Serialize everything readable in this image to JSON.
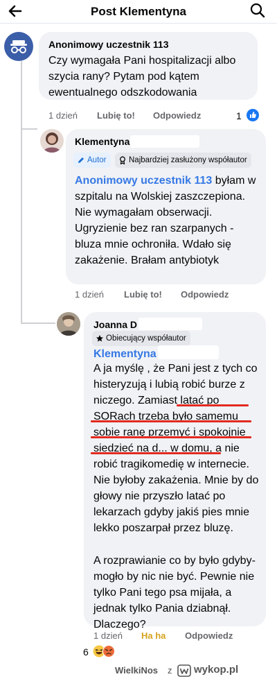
{
  "header": {
    "title": "Post Klementyna"
  },
  "comments": [
    {
      "author": "Anonimowy uczestnik 113",
      "text": "Czy wymagała Pani hospitalizacji albo szycia rany? Pytam pod kątem ewentualnego odszkodowania",
      "time": "1 dzień",
      "like": "Lubię to!",
      "reply": "Odpowiedz",
      "reactions_count": "1"
    },
    {
      "author": "Klementyna",
      "badges": [
        "Autor",
        "Najbardziej zasłużony współautor"
      ],
      "mention": "Anonimowy uczestnik 113",
      "text": " byłam w szpitalu na Wolskiej zaszczepiona. Nie wymagałam obserwacji. Ugryzienie bez ran szarpanych - bluza mnie ochroniła. Wdało się zakażenie. Brałam antybiotyk",
      "time": "1 dzień",
      "like": "Lubię to!",
      "reply": "Odpowiedz"
    },
    {
      "author": "Joanna D",
      "badge": "Obiecujący współautor",
      "mention": "Klementyna",
      "text_a": "A ja myślę , że Pani jest z tych co histeryzują i lubią robić burze z niczego. ",
      "text_underlined": "Zamiast latać po SORach trzeba było samemu sobie ranę przemyć i spokojnie siedzieć na d...",
      "text_b": " w domu, a nie robić tragikomedię w internecie. Nie byłoby zakażenia. Mnie by do głowy nie przyszło latać po lekarzach gdyby jakiś pies mnie lekko poszarpał przez bluzę.",
      "text_c": "A rozprawianie co by było gdyby- mogło by nic nie być. Pewnie nie tylko Pani tego psa mijała, a jednak tylko Pania dziabnął. Dlaczego?",
      "time": "1 dzień",
      "reaction": "Ha ha",
      "reply": "Odpowiedz",
      "reactions_count": "6"
    }
  ],
  "footer": {
    "user": "WielkiNos",
    "separator": "z",
    "brand": "wykop.pl"
  },
  "colors": {
    "accent": "#1877f2",
    "mention": "#3578e5",
    "haha": "#d7a31e",
    "underline": "#e32a20"
  },
  "icons": [
    "back-arrow-icon",
    "search-icon",
    "incognito-icon",
    "like-icon",
    "pencil-icon",
    "award-icon",
    "star-icon",
    "haha-icon",
    "angry-icon",
    "wykop-logo-icon"
  ]
}
